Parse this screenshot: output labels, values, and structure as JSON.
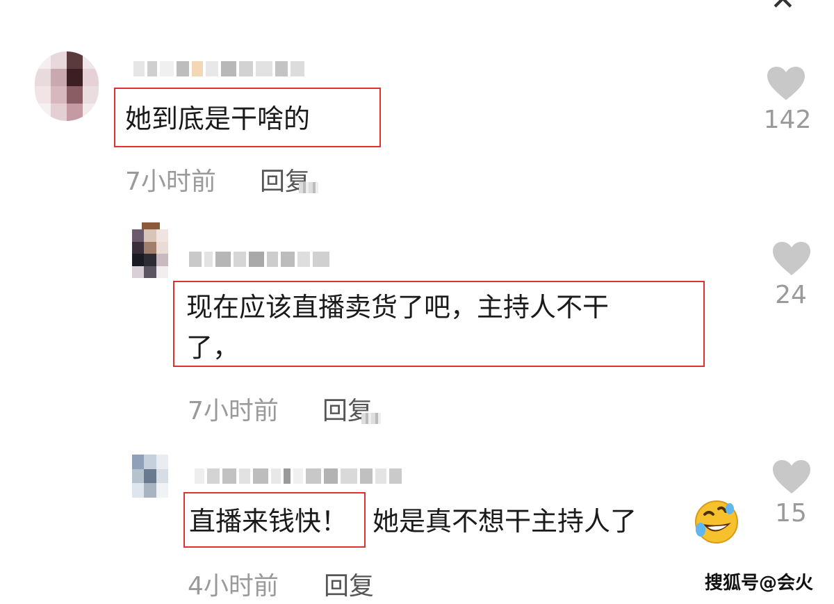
{
  "close_glyph": "✕",
  "comments": [
    {
      "text": "她到底是干啥的",
      "time": "7小时前",
      "reply": "回复",
      "likes": "142"
    },
    {
      "text_line1": "现在应该直播卖货了吧，主持人不干",
      "text_line2": "了，",
      "time": "7小时前",
      "reply": "回复",
      "likes": "24"
    },
    {
      "highlight": "直播来钱快！",
      "rest": "她是真不想干主持人了",
      "time": "4小时前",
      "reply": "回复",
      "likes": "15",
      "emoji": "rolling-laughing-emoji"
    }
  ],
  "watermark": "搜狐号@会火",
  "colors": {
    "highlight_border": "#e03131",
    "meta_text": "#9a9a9a",
    "heart": "#c8c8c8"
  }
}
